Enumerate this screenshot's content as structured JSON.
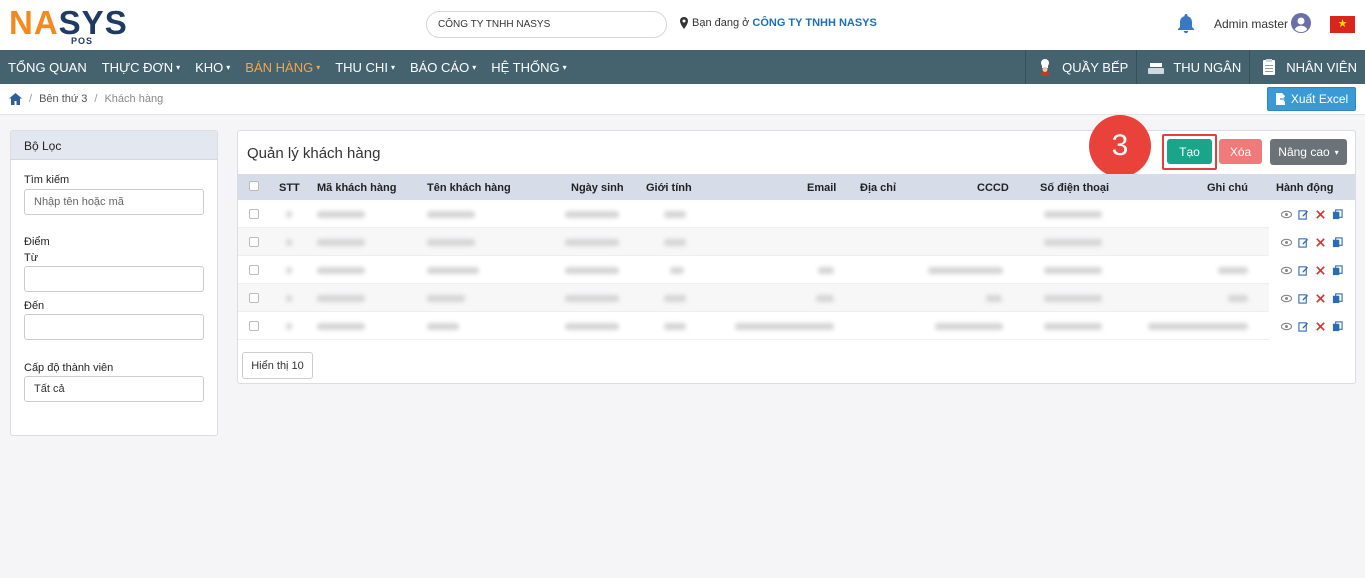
{
  "brand": {
    "logo_left": "NA",
    "logo_right": "SYS",
    "logo_sub": "POS"
  },
  "header": {
    "company": "CÔNG TY TNHH NASYS",
    "location_prefix": "Bạn đang ở",
    "location_company": "CÔNG TY TNHH NASYS",
    "user": "Admin master"
  },
  "nav": {
    "items": [
      {
        "label": "TỔNG QUAN",
        "caret": ""
      },
      {
        "label": "THỰC ĐƠN",
        "caret": "▾"
      },
      {
        "label": "KHO",
        "caret": "▾"
      },
      {
        "label": "BÁN HÀNG",
        "caret": "▾"
      },
      {
        "label": "THU CHI",
        "caret": "▾"
      },
      {
        "label": "BÁO CÁO",
        "caret": "▾"
      },
      {
        "label": "HỆ THỐNG",
        "caret": "▾"
      }
    ],
    "active_index": 3,
    "right": {
      "kitchen": "QUẦY BẾP",
      "cashier": "THU NGÂN",
      "staff": "NHÂN VIÊN"
    }
  },
  "breadcrumb": {
    "parent": "Bên thứ 3",
    "current": "Khách hàng"
  },
  "toolbar": {
    "export_label": "Xuất Excel"
  },
  "filter": {
    "title": "Bộ Lọc",
    "search_label": "Tìm kiếm",
    "search_placeholder": "Nhập tên hoặc mã",
    "points_label": "Điểm",
    "from_label": "Từ",
    "to_label": "Đến",
    "level_label": "Cấp độ thành viên",
    "level_value": "Tất cả"
  },
  "card": {
    "title": "Quản lý khách hàng",
    "step_number": "3",
    "create_label": "Tạo",
    "delete_label": "Xóa",
    "advanced_label": "Nâng cao",
    "page_size_label": "Hiển thị 10"
  },
  "table": {
    "columns": [
      "STT",
      "Mã khách hàng",
      "Tên khách hàng",
      "Ngày sinh",
      "Giới tính",
      "Email",
      "Địa chỉ",
      "CCCD",
      "Số điện thoại",
      "Ghi chú",
      "Hành động"
    ]
  },
  "colors": {
    "nav_bg": "#45636f",
    "nav_active": "#f5a54a",
    "create": "#18a58a",
    "delete": "#f07a7a",
    "export": "#3a9ad5",
    "step_badge": "#e8423a"
  }
}
